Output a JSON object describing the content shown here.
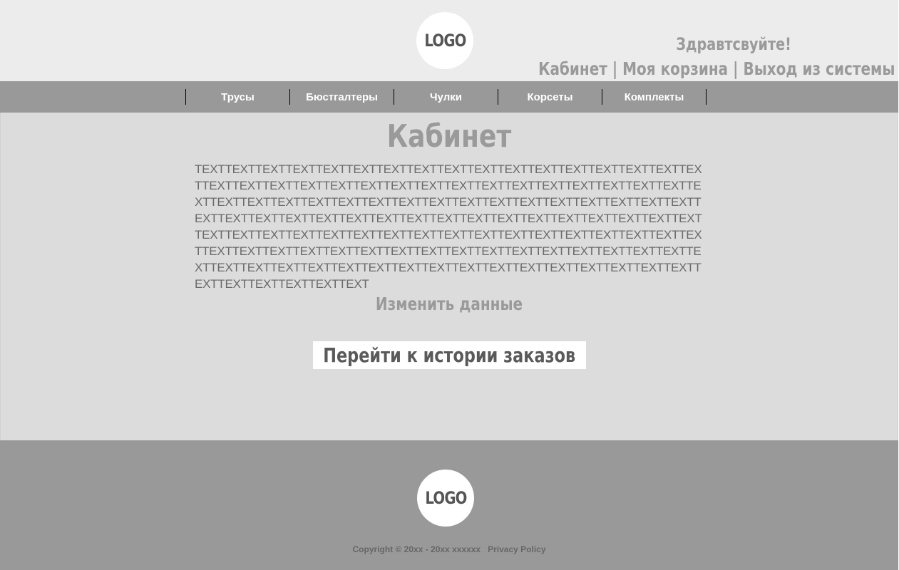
{
  "header": {
    "logo": "LOGO",
    "greeting": "Здравтсвуйте!",
    "links": {
      "cabinet": "Кабинет",
      "cart": "Моя корзина",
      "logout": "Выход из системы",
      "separator": "|"
    }
  },
  "nav": {
    "items": [
      "Трусы",
      "Бюстгалтеры",
      "Чулки",
      "Корсеты",
      "Комплекты"
    ]
  },
  "main": {
    "title": "Кабинет",
    "body_text": "TEXTTEXTTEXTTEXTTEXTTEXTTEXTTEXTTEXTTEXTTEXTTEXTTEXTTEXTTEXTTEXTTEXTTEXTTEXTTEXTTEXTTEXTTEXTTEXTTEXTTEXTTEXTTEXTTEXTTEXTTEXTTEXTTEXTTEXTTEXTTEXTTEXTTEXTTEXTTEXTTEXTTEXTTEXTTEXTTEXTTEXTTEXTTEXTTEXTTEXTTEXTTEXTTEXTTEXTTEXTTEXTTEXTTEXTTEXTTEXTTEXTTEXTTEXTTEXTTEXTTEXTTEXTTEXTTEXTTEXTTEXTTEXTTEXTTEXTTEXTTEXTTEXTTEXTTEXTTEXTTEXTTEXTTEXTTEXTTEXTTEXTTEXTTEXTTEXTTEXTTEXTTEXTTEXTTEXTTEXTTEXTTEXTTEXTTEXTTEXTTEXTTEXTTEXTTEXTTEXTTEXTTEXTTEXTTEXTTEXTTEXTTEXTTEXTTEXTTEXTTEXTTEXTTEXTTEXTTEXTTEXTTEXTTEXT",
    "edit_link": "Изменить данные",
    "history_button": "Перейти к истории заказов"
  },
  "footer": {
    "logo": "LOGO",
    "copyright": "Copyright © 20xx - 20xx xxxxxx",
    "privacy": "Privacy Policy"
  },
  "colors": {
    "header_bg": "#ececec",
    "nav_bg": "#999999",
    "main_bg": "#dcdcdc",
    "footer_bg": "#999999"
  }
}
